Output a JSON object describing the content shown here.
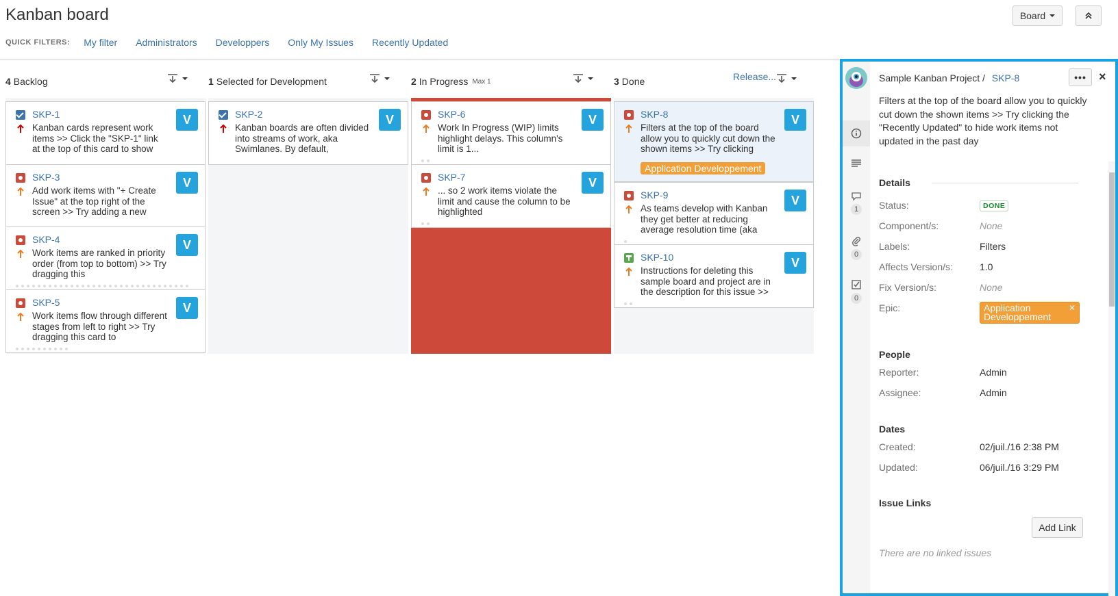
{
  "header": {
    "title": "Kanban board",
    "board_button": "Board",
    "quick_filters_label": "QUICK FILTERS:",
    "quick_filters": [
      "My filter",
      "Administrators",
      "Developpers",
      "Only My Issues",
      "Recently Updated"
    ]
  },
  "columns": [
    {
      "count": "4",
      "name": "Backlog",
      "max": ""
    },
    {
      "count": "1",
      "name": "Selected for Development",
      "max": ""
    },
    {
      "count": "2",
      "name": "In Progress",
      "max": "Max 1"
    },
    {
      "count": "3",
      "name": "Done",
      "max": "",
      "release_link": "Release..."
    }
  ],
  "cards": [
    {
      "key": "SKP-1",
      "type": "story",
      "priority": "highest",
      "avatar": "V",
      "summary": "Kanban cards represent work items >> Click the \"SKP-1\" link at the top of this card to show"
    },
    {
      "key": "SKP-3",
      "type": "bug",
      "priority": "medium",
      "avatar": "V",
      "summary": "Add work items with \"+ Create Issue\" at the top right of the screen >> Try adding a new"
    },
    {
      "key": "SKP-4",
      "type": "bug",
      "priority": "medium",
      "avatar": "V",
      "summary": "Work items are ranked in priority order (from top to bottom) >> Try dragging this"
    },
    {
      "key": "SKP-5",
      "type": "bug",
      "priority": "medium",
      "avatar": "V",
      "summary": "Work items flow through different stages from left to right >> Try dragging this card to"
    },
    {
      "key": "SKP-2",
      "type": "story",
      "priority": "highest",
      "avatar": "V",
      "summary": "Kanban boards are often divided into streams of work, aka Swimlanes. By default,"
    },
    {
      "key": "SKP-6",
      "type": "bug",
      "priority": "medium",
      "avatar": "V",
      "summary": "Work In Progress (WIP) limits highlight delays. This column's limit is 1..."
    },
    {
      "key": "SKP-7",
      "type": "bug",
      "priority": "medium",
      "avatar": "V",
      "summary": "... so 2 work items violate the limit and cause the column to be highlighted"
    },
    {
      "key": "SKP-8",
      "type": "bug",
      "priority": "medium",
      "avatar": "V",
      "summary": "Filters at the top of the board allow you to quickly cut down the shown items >> Try clicking",
      "epic": "Application Developpement"
    },
    {
      "key": "SKP-9",
      "type": "bug",
      "priority": "medium",
      "avatar": "V",
      "summary": "As teams develop with Kanban they get better at reducing average resolution time (aka"
    },
    {
      "key": "SKP-10",
      "type": "task",
      "priority": "medium",
      "avatar": "V",
      "summary": "Instructions for deleting this sample board and project are in the description for this issue >>"
    }
  ],
  "detail": {
    "project": "Sample Kanban Project",
    "separator": "/",
    "key": "SKP-8",
    "more": "•••",
    "close": "×",
    "summary": "Filters at the top of the board allow you to quickly cut down the shown items >> Try clicking the \"Recently Updated\" to hide work items not updated in the past day",
    "sidebar_counts": {
      "comments": "1",
      "attachments": "0",
      "subtasks": "0"
    },
    "details_title": "Details",
    "status_label": "Status:",
    "status_value": "DONE",
    "component_label": "Component/s:",
    "component_value": "None",
    "labels_label": "Labels:",
    "labels_value": "Filters",
    "affects_label": "Affects Version/s:",
    "affects_value": "1.0",
    "fix_label": "Fix Version/s:",
    "fix_value": "None",
    "epic_label": "Epic:",
    "epic_value": "Application Developpement",
    "people_title": "People",
    "reporter_label": "Reporter:",
    "reporter_value": "Admin",
    "assignee_label": "Assignee:",
    "assignee_value": "Admin",
    "dates_title": "Dates",
    "created_label": "Created:",
    "created_value": "02/juil./16 2:38 PM",
    "updated_label": "Updated:",
    "updated_value": "06/juil./16 3:29 PM",
    "links_title": "Issue Links",
    "add_link": "Add Link",
    "no_links": "There are no linked issues"
  },
  "colors": {
    "accent": "#1ba2e0",
    "link": "#3b73af",
    "wip": "#cd4a3b",
    "epic": "#f29f38",
    "avatar": "#24a3dc"
  },
  "icons": [
    "story-icon",
    "bug-icon",
    "task-icon",
    "priority-highest-icon",
    "priority-medium-icon",
    "info-icon",
    "description-icon",
    "comment-icon",
    "attachment-icon",
    "subtask-icon"
  ]
}
